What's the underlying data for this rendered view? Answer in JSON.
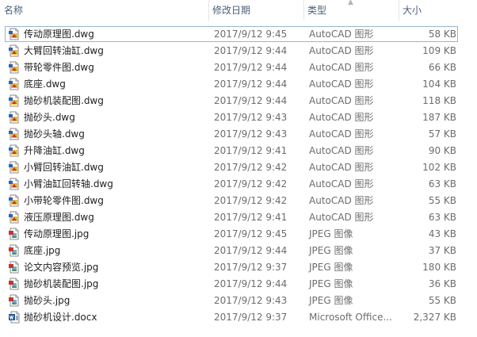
{
  "columns": {
    "name": "名称",
    "date": "修改日期",
    "type": "类型",
    "size": "大小"
  },
  "sort": {
    "column": "type",
    "icon": "sort-up-arrow-icon"
  },
  "files": [
    {
      "name": "传动原理图.dwg",
      "date": "2017/9/12 9:45",
      "type": "AutoCAD 图形",
      "size": "58 KB",
      "icon": "autocad-file-icon",
      "focused": true
    },
    {
      "name": "大臂回转油缸.dwg",
      "date": "2017/9/12 9:44",
      "type": "AutoCAD 图形",
      "size": "109 KB",
      "icon": "autocad-file-icon"
    },
    {
      "name": "带轮零件图.dwg",
      "date": "2017/9/12 9:44",
      "type": "AutoCAD 图形",
      "size": "66 KB",
      "icon": "autocad-file-icon"
    },
    {
      "name": "底座.dwg",
      "date": "2017/9/12 9:44",
      "type": "AutoCAD 图形",
      "size": "104 KB",
      "icon": "autocad-file-icon"
    },
    {
      "name": "抛砂机装配图.dwg",
      "date": "2017/9/12 9:44",
      "type": "AutoCAD 图形",
      "size": "118 KB",
      "icon": "autocad-file-icon"
    },
    {
      "name": "抛砂头.dwg",
      "date": "2017/9/12 9:43",
      "type": "AutoCAD 图形",
      "size": "187 KB",
      "icon": "autocad-file-icon"
    },
    {
      "name": "抛砂头轴.dwg",
      "date": "2017/9/12 9:43",
      "type": "AutoCAD 图形",
      "size": "57 KB",
      "icon": "autocad-file-icon"
    },
    {
      "name": "升降油缸.dwg",
      "date": "2017/9/12 9:41",
      "type": "AutoCAD 图形",
      "size": "90 KB",
      "icon": "autocad-file-icon"
    },
    {
      "name": "小臂回转油缸.dwg",
      "date": "2017/9/12 9:42",
      "type": "AutoCAD 图形",
      "size": "102 KB",
      "icon": "autocad-file-icon"
    },
    {
      "name": "小臂油缸回转轴.dwg",
      "date": "2017/9/12 9:42",
      "type": "AutoCAD 图形",
      "size": "63 KB",
      "icon": "autocad-file-icon"
    },
    {
      "name": "小带轮零件图.dwg",
      "date": "2017/9/12 9:42",
      "type": "AutoCAD 图形",
      "size": "55 KB",
      "icon": "autocad-file-icon"
    },
    {
      "name": "液压原理图.dwg",
      "date": "2017/9/12 9:41",
      "type": "AutoCAD 图形",
      "size": "63 KB",
      "icon": "autocad-file-icon"
    },
    {
      "name": "传动原理图.jpg",
      "date": "2017/9/12 9:45",
      "type": "JPEG 图像",
      "size": "43 KB",
      "icon": "jpeg-file-icon"
    },
    {
      "name": "底座.jpg",
      "date": "2017/9/12 9:44",
      "type": "JPEG 图像",
      "size": "37 KB",
      "icon": "jpeg-file-icon"
    },
    {
      "name": "论文内容预览.jpg",
      "date": "2017/9/12 9:37",
      "type": "JPEG 图像",
      "size": "180 KB",
      "icon": "jpeg-file-icon"
    },
    {
      "name": "抛砂机装配图.jpg",
      "date": "2017/9/12 9:44",
      "type": "JPEG 图像",
      "size": "36 KB",
      "icon": "jpeg-file-icon"
    },
    {
      "name": "抛砂头.jpg",
      "date": "2017/9/12 9:43",
      "type": "JPEG 图像",
      "size": "55 KB",
      "icon": "jpeg-file-icon"
    },
    {
      "name": "抛砂机设计.docx",
      "date": "2017/9/12 9:37",
      "type": "Microsoft Office...",
      "size": "2,327 KB",
      "icon": "word-document-icon"
    }
  ]
}
